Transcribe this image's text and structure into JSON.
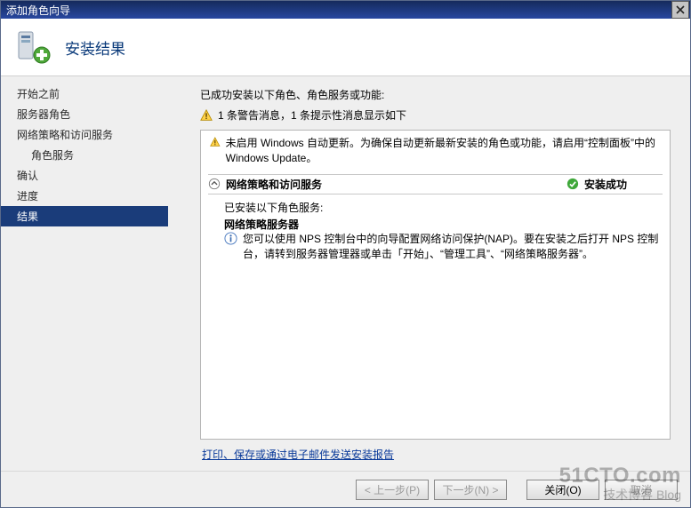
{
  "titlebar": {
    "title": "添加角色向导"
  },
  "header": {
    "title": "安装结果"
  },
  "sidebar": {
    "items": [
      {
        "label": "开始之前"
      },
      {
        "label": "服务器角色"
      },
      {
        "label": "网络策略和访问服务"
      },
      {
        "label": "角色服务"
      },
      {
        "label": "确认"
      },
      {
        "label": "进度"
      },
      {
        "label": "结果"
      }
    ]
  },
  "content": {
    "intro": "已成功安装以下角色、角色服务或功能:",
    "warn_counts": "1 条警告消息，1 条提示性消息显示如下",
    "update_warning": "未启用 Windows 自动更新。为确保自动更新最新安装的角色或功能，请启用“控制面板”中的 Windows Update。",
    "section_title": "网络策略和访问服务",
    "section_status": "安装成功",
    "installed_line": "已安装以下角色服务:",
    "installed_role": "网络策略服务器",
    "info_text": "您可以使用 NPS 控制台中的向导配置网络访问保护(NAP)。要在安装之后打开 NPS 控制台，请转到服务器管理器或单击「开始」、“管理工具”、“网络策略服务器”。",
    "report_link": "打印、保存或通过电子邮件发送安装报告"
  },
  "footer": {
    "prev": "< 上一步(P)",
    "next": "下一步(N) >",
    "close": "关闭(O)",
    "cancel": "取消"
  },
  "watermark": {
    "top": "51CTO.com",
    "bot": "技术博客 Blog"
  }
}
